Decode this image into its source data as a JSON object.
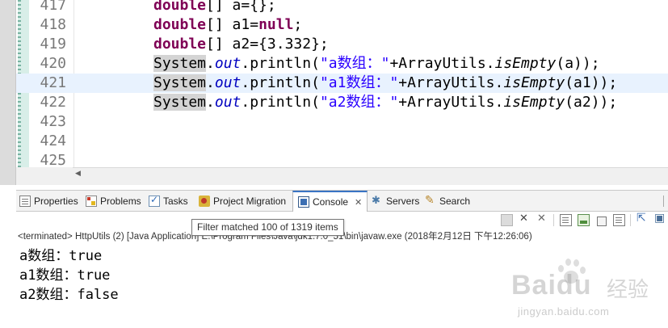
{
  "editor": {
    "lines": [
      {
        "num": "417",
        "tokens": [
          {
            "t": "double",
            "c": "kw"
          },
          {
            "t": "[] a={};",
            "c": ""
          }
        ]
      },
      {
        "num": "418",
        "tokens": [
          {
            "t": "double",
            "c": "kw"
          },
          {
            "t": "[] a1=",
            "c": ""
          },
          {
            "t": "null",
            "c": "kw"
          },
          {
            "t": ";",
            "c": ""
          }
        ]
      },
      {
        "num": "419",
        "tokens": [
          {
            "t": "double",
            "c": "kw"
          },
          {
            "t": "[] a2={3.332};",
            "c": ""
          }
        ]
      },
      {
        "num": "420",
        "tokens": [
          {
            "t": "System",
            "c": "occ"
          },
          {
            "t": ".",
            "c": ""
          },
          {
            "t": "out",
            "c": "field"
          },
          {
            "t": ".println(",
            "c": ""
          },
          {
            "t": "\"a数组：\"",
            "c": "str"
          },
          {
            "t": "+ArrayUtils.",
            "c": ""
          },
          {
            "t": "isEmpty",
            "c": "stat"
          },
          {
            "t": "(a));",
            "c": ""
          }
        ]
      },
      {
        "num": "421",
        "current": true,
        "tokens": [
          {
            "t": "System",
            "c": "occ"
          },
          {
            "t": ".",
            "c": ""
          },
          {
            "t": "out",
            "c": "field"
          },
          {
            "t": ".println(",
            "c": ""
          },
          {
            "t": "\"a1数组：\"",
            "c": "str"
          },
          {
            "t": "+ArrayUtils.",
            "c": ""
          },
          {
            "t": "isEmpty",
            "c": "stat"
          },
          {
            "t": "(a1));",
            "c": ""
          }
        ]
      },
      {
        "num": "422",
        "tokens": [
          {
            "t": "System",
            "c": "occ"
          },
          {
            "t": ".",
            "c": ""
          },
          {
            "t": "out",
            "c": "field"
          },
          {
            "t": ".println(",
            "c": ""
          },
          {
            "t": "\"a2数组：\"",
            "c": "str"
          },
          {
            "t": "+ArrayUtils.",
            "c": ""
          },
          {
            "t": "isEmpty",
            "c": "stat"
          },
          {
            "t": "(a2));",
            "c": ""
          }
        ]
      },
      {
        "num": "423",
        "tokens": []
      },
      {
        "num": "424",
        "tokens": []
      },
      {
        "num": "425",
        "tokens": []
      }
    ]
  },
  "tabs": [
    {
      "label": "Properties",
      "icon": "properties-icon"
    },
    {
      "label": "Problems",
      "icon": "problems-icon"
    },
    {
      "label": "Tasks",
      "icon": "tasks-icon"
    },
    {
      "label": "Project Migration",
      "icon": "project-migration-icon"
    },
    {
      "label": "Console",
      "icon": "console-icon",
      "active": true,
      "close": "✕"
    },
    {
      "label": "Servers",
      "icon": "servers-icon"
    },
    {
      "label": "Search",
      "icon": "search-icon"
    }
  ],
  "tooltip": "Filter matched 100 of 1319 items",
  "console": {
    "status": "<terminated> HttpUtils (2) [Java Application] E:\\Program Files\\Java\\jdk1.7.0_51\\bin\\javaw.exe (2018年2月12日 下午12:26:06)",
    "output": [
      "a数组：true",
      "a1数组：true",
      "a2数组：false"
    ]
  },
  "watermark": {
    "brand": "Bai",
    "brand2": "du",
    "cn": "经验",
    "url": "jingyan.baidu.com"
  },
  "colors": {
    "keyword": "#7f0055",
    "string": "#2a00ff",
    "field": "#0000c0",
    "current_line": "#e8f2fe",
    "active_tab_accent": "#3a74c4"
  }
}
